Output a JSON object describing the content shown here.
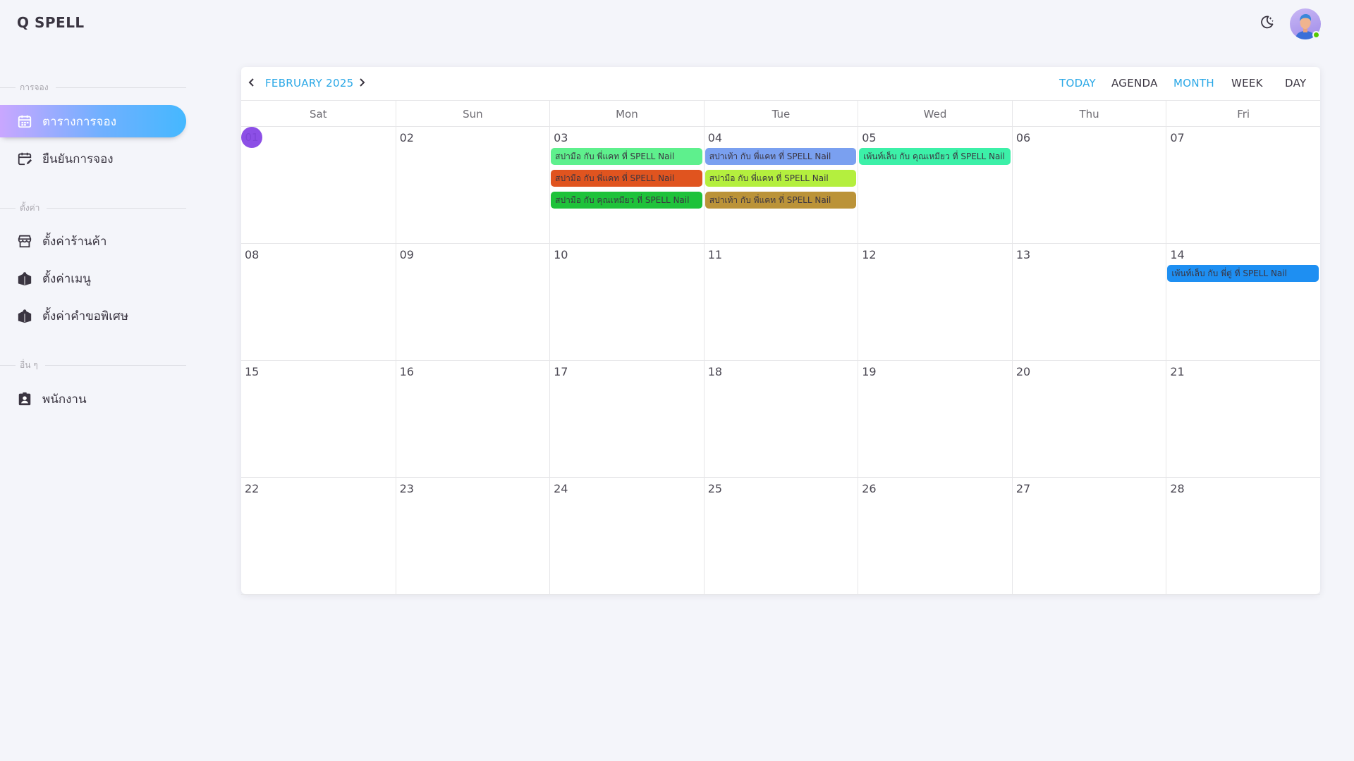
{
  "header": {
    "app_title": "Q SPELL",
    "theme_icon": "moon-star-icon",
    "avatar_status_color": "#56ca00"
  },
  "sidebar": {
    "sections": [
      {
        "label": "การจอง"
      },
      {
        "label": "ตั้งค่า"
      },
      {
        "label": "อื่น ๆ"
      }
    ],
    "items": [
      {
        "label": "ตารางการจอง",
        "icon": "calendar-icon",
        "active": true
      },
      {
        "label": "ยืนยันการจอง",
        "icon": "calendar-edit-icon"
      },
      {
        "label": "ตั้งค่าร้านค้า",
        "icon": "store-icon"
      },
      {
        "label": "ตั้งค่าเมนู",
        "icon": "book-open-icon"
      },
      {
        "label": "ตั้งค่าคำขอพิเศษ",
        "icon": "book-open-icon"
      },
      {
        "label": "พนักงาน",
        "icon": "badge-account-icon"
      }
    ]
  },
  "calendar": {
    "month_label": "FEBRUARY 2025",
    "views": {
      "today": "TODAY",
      "agenda": "AGENDA",
      "month": "MONTH",
      "week": "WEEK",
      "day": "DAY"
    },
    "active_view": "MONTH",
    "accent_color": "#29a7e6",
    "weekdays": [
      "Sat",
      "Sun",
      "Mon",
      "Tue",
      "Wed",
      "Thu",
      "Fri"
    ],
    "weeks": [
      [
        "01",
        "02",
        "03",
        "04",
        "05",
        "06",
        "07"
      ],
      [
        "08",
        "09",
        "10",
        "11",
        "12",
        "13",
        "14"
      ],
      [
        "15",
        "16",
        "17",
        "18",
        "19",
        "20",
        "21"
      ],
      [
        "22",
        "23",
        "24",
        "25",
        "26",
        "27",
        "28"
      ]
    ],
    "today": "01",
    "events": [
      {
        "day": "03",
        "title": "สปามือ กับ พี่แคท ที่ SPELL Nail",
        "color": "#5ef08d"
      },
      {
        "day": "03",
        "title": "สปามือ กับ พี่แคท ที่ SPELL Nail",
        "color": "#e0541f"
      },
      {
        "day": "03",
        "title": "สปามือ กับ คุณเหมียว ที่ SPELL Nail",
        "color": "#1ec23a"
      },
      {
        "day": "04",
        "title": "สปาเท้า กับ พี่แคท ที่ SPELL Nail",
        "color": "#7aa0f0"
      },
      {
        "day": "04",
        "title": "สปามือ กับ พี่แคท ที่ SPELL Nail",
        "color": "#b4ef3e"
      },
      {
        "day": "04",
        "title": "สปาเท้า กับ พี่แคท ที่ SPELL Nail",
        "color": "#bb9338"
      },
      {
        "day": "05",
        "title": "เพ้นท์เล็บ กับ คุณเหมียว ที่ SPELL Nail",
        "color": "#3cf0a8"
      },
      {
        "day": "14",
        "title": "เพ้นท์เล็บ กับ พี่ตู่ ที่ SPELL Nail",
        "color": "#1e8ff2"
      }
    ]
  }
}
